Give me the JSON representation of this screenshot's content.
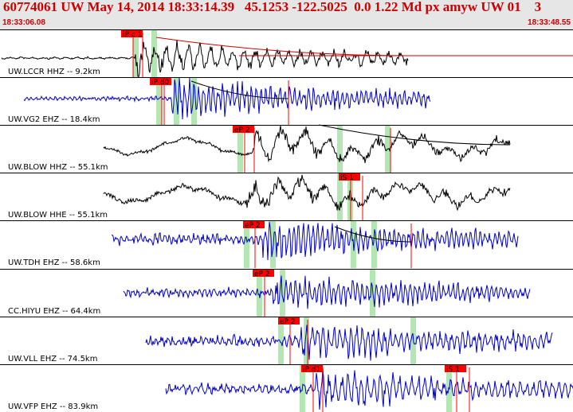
{
  "header": {
    "title": "60774061 UW May 14, 2014 18:33:14.39   45.1253 -122.5025  0.0 1.22 Md px amyw UW 01    3",
    "start_time": "18:33:06.08",
    "end_time": "18:33:48.55"
  },
  "colors": {
    "header_bg": "#e6e6e6",
    "header_text": "#cc0000",
    "trace_hh": "#000000",
    "trace_eh": "#0000cc",
    "pick": "#ff0000",
    "window": "#b4e6b4",
    "fit": "#cc0000"
  },
  "traces": [
    {
      "label": "UW.LCCR HHZ -- 9.2km",
      "color": "#000000",
      "picks": [
        "iP c 1"
      ]
    },
    {
      "label": "UW.VG2 EHZ -- 18.4km",
      "color": "#0000cc",
      "picks": [
        "iP d0"
      ]
    },
    {
      "label": "UW.BLOW HHZ -- 55.1km",
      "color": "#000000",
      "picks": [
        "eP 2"
      ]
    },
    {
      "label": "UW.BLOW HHE -- 55.1km",
      "color": "#000000",
      "picks": [
        "iS 1"
      ]
    },
    {
      "label": "UW.TDH EHZ -- 58.6km",
      "color": "#0000cc",
      "picks": [
        "eP 2"
      ]
    },
    {
      "label": "CC.HIYU EHZ -- 64.4km",
      "color": "#0000cc",
      "picks": [
        "eP 2"
      ]
    },
    {
      "label": "UW.VLL EHZ -- 74.5km",
      "color": "#0000cc",
      "picks": [
        "eP 2"
      ]
    },
    {
      "label": "UW.VFP EHZ -- 83.9km",
      "color": "#0000cc",
      "picks": [
        "iP d1",
        "iS 1"
      ]
    }
  ]
}
